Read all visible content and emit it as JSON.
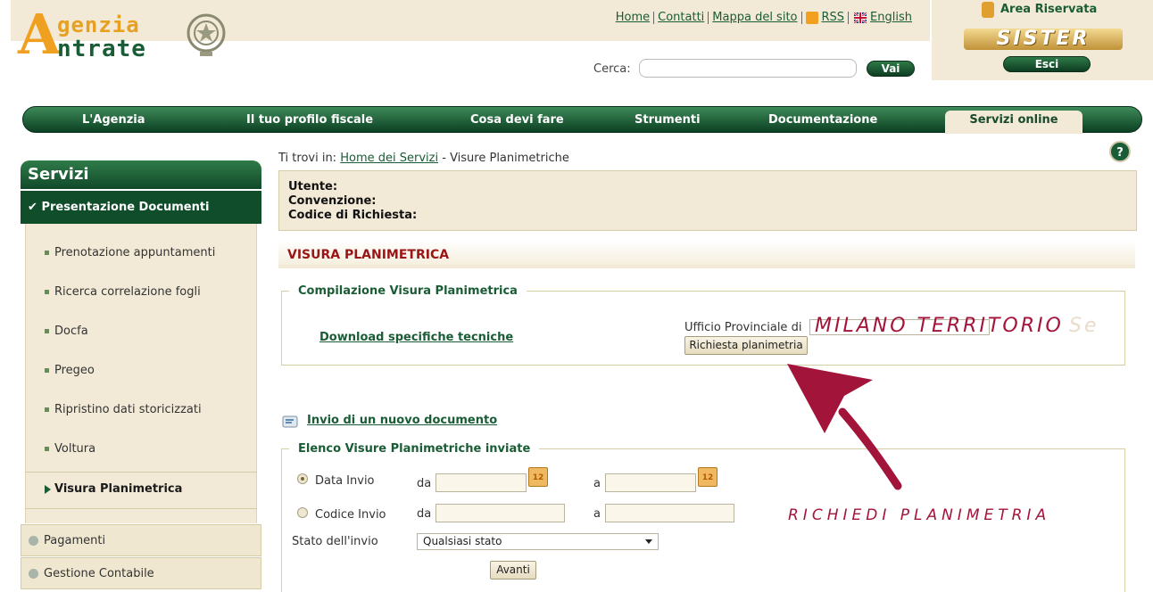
{
  "logo": {
    "line1": "genzia",
    "line2": "ntrate",
    "initial": "A"
  },
  "header": {
    "links": [
      "Home",
      "Contatti",
      "Mappa del sito",
      "RSS",
      "English"
    ],
    "search_label": "Cerca:",
    "search_value": "",
    "search_button": "Vai"
  },
  "reserved": {
    "title": "Area Riservata",
    "brand": "SISTER",
    "logout": "Esci"
  },
  "nav": {
    "items": [
      "L'Agenzia",
      "Il tuo profilo fiscale",
      "Cosa devi fare",
      "Strumenti",
      "Documentazione",
      "Servizi online"
    ],
    "active": "Servizi online"
  },
  "sidebar": {
    "title": "Servizi",
    "section": "Presentazione Documenti",
    "items": [
      "Prenotazione appuntamenti",
      "Ricerca correlazione fogli",
      "Docfa",
      "Pregeo",
      "Ripristino dati storicizzati",
      "Voltura",
      "Visura Planimetrica"
    ],
    "current": "Visura Planimetrica",
    "accordion": [
      "Pagamenti",
      "Gestione Contabile"
    ]
  },
  "breadcrumb": {
    "prefix": "Ti trovi in:",
    "home": "Home dei Servizi",
    "sep": "-",
    "current": "Visure Planimetriche"
  },
  "info": {
    "utente": "Utente:",
    "convenzione": "Convenzione:",
    "codice": "Codice di Richiesta:"
  },
  "page_title": "VISURA PLANIMETRICA",
  "compilazione": {
    "legend": "Compilazione Visura Planimetrica",
    "download": "Download specifiche tecniche",
    "ufficio_label": "Ufficio Provinciale di",
    "ufficio_value": "MILANO TERRITORIO",
    "ufficio_overflow": "Se",
    "request_button": "Richiesta planimetria"
  },
  "nuovo": "Invio di un nuovo documento",
  "elenco": {
    "legend": "Elenco Visure Planimetriche inviate",
    "data_invio": "Data Invio",
    "codice_invio": "Codice Invio",
    "da": "da",
    "a": "a",
    "cal_label": "12",
    "stato_label": "Stato dell'invio",
    "stato_value": "Qualsiasi stato",
    "avanti": "Avanti"
  },
  "annotation": "RICHIEDI PLANIMETRIA",
  "colors": {
    "green": "#1a5c35",
    "beige": "#f2ead7",
    "title_red": "#9a1515",
    "annotation": "#a3143a"
  }
}
